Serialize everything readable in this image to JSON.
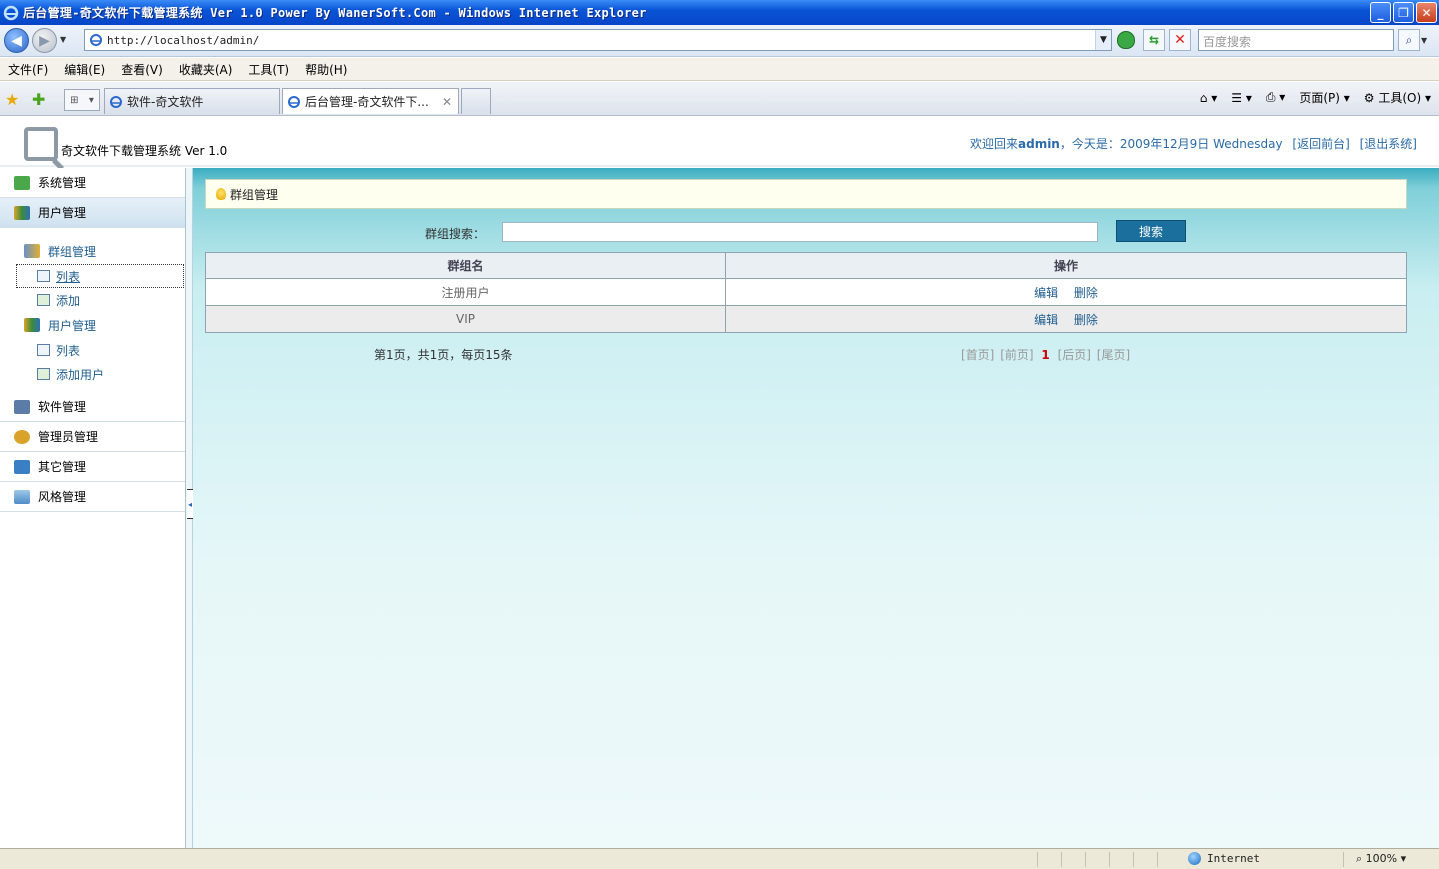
{
  "window": {
    "title": "后台管理-奇文软件下载管理系统 Ver 1.0 Power By WanerSoft.Com - Windows Internet Explorer",
    "minimize": "_",
    "maximize": "❐",
    "close": "✕"
  },
  "address": {
    "url": "http://localhost/admin/",
    "search_placeholder": "百度搜索"
  },
  "menu": [
    "文件(F)",
    "编辑(E)",
    "查看(V)",
    "收藏夹(A)",
    "工具(T)",
    "帮助(H)"
  ],
  "tabs": [
    {
      "label": "软件-奇文软件"
    },
    {
      "label": "后台管理-奇文软件下..."
    }
  ],
  "commands": {
    "page": "页面(P)",
    "tools": "工具(O)"
  },
  "header": {
    "app_name": "奇文软件下载管理系统  Ver 1.0",
    "welcome_prefix": "欢迎回来",
    "user": "admin",
    "date_text": "，今天是：2009年12月9日 Wednesday",
    "back_link": "[返回前台]",
    "logout_link": "[退出系统]"
  },
  "sidebar": {
    "system": "系统管理",
    "users": "用户管理",
    "group_mgmt": "群组管理",
    "group_list": "列表",
    "group_add": "添加",
    "user_mgmt": "用户管理",
    "user_list": "列表",
    "user_add": "添加用户",
    "software": "软件管理",
    "admin": "管理员管理",
    "other": "其它管理",
    "style": "风格管理"
  },
  "main": {
    "crumb": "群组管理",
    "search_label": "群组搜索：",
    "search_button": "搜索",
    "columns": [
      "群组名",
      "操作"
    ],
    "rows": [
      {
        "name": "注册用户",
        "edit": "编辑",
        "delete": "删除"
      },
      {
        "name": "VIP",
        "edit": "编辑",
        "delete": "删除"
      }
    ],
    "pager_info": "第1页，共1页，每页15条",
    "pager": {
      "first": "[首页]",
      "prev": "[前页]",
      "current": "1",
      "next": "[后页]",
      "last": "[尾页]"
    }
  },
  "status": {
    "zone": "Internet",
    "zoom": "100%"
  }
}
